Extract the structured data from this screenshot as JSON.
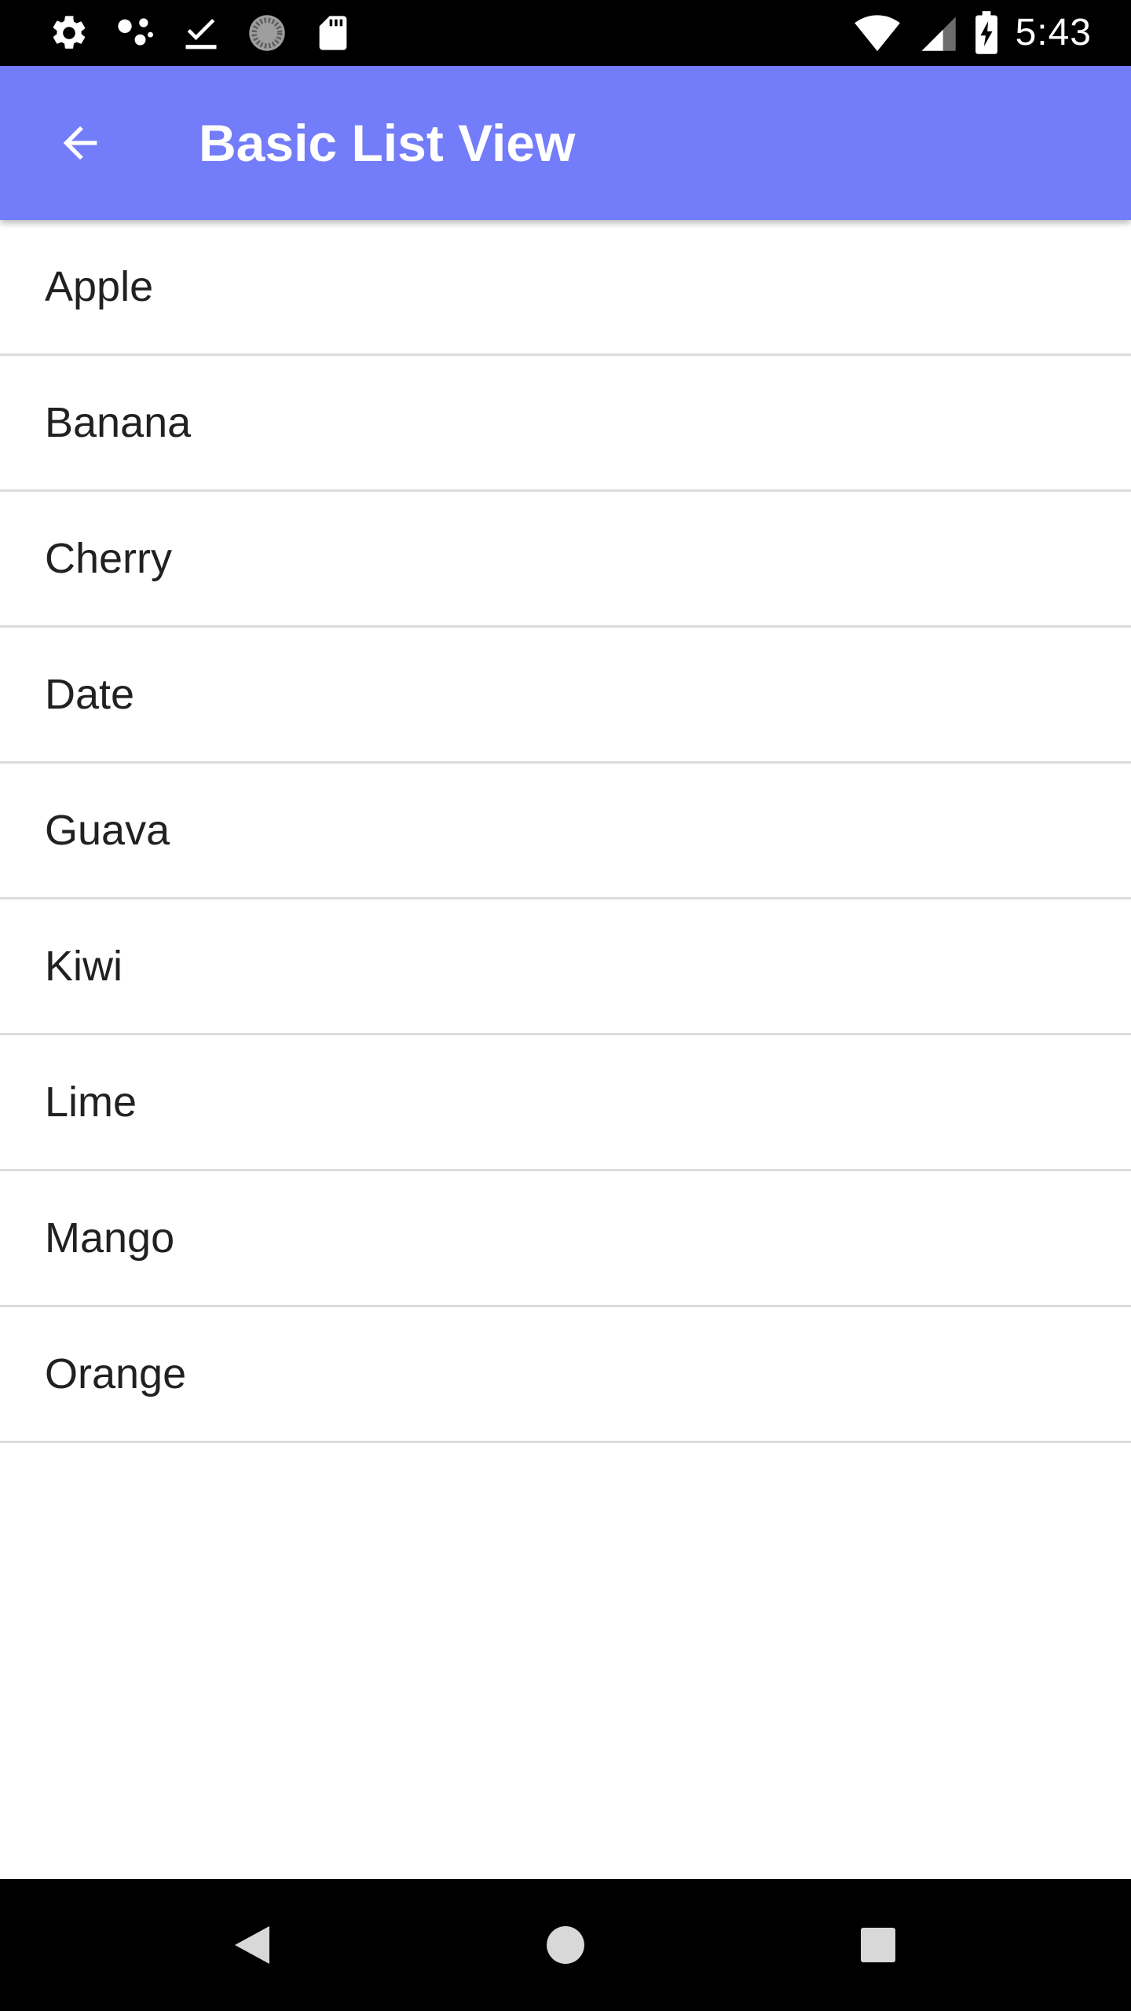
{
  "status_bar": {
    "time": "5:43",
    "left_icons": [
      "settings-icon",
      "assistant-dots-icon",
      "download-done-icon",
      "sync-progress-icon",
      "sd-card-icon"
    ],
    "right_icons": [
      "wifi-icon",
      "cell-signal-icon",
      "battery-charging-icon"
    ]
  },
  "app_bar": {
    "title": "Basic List View",
    "back_icon": "arrow-back-icon",
    "color": "#737cf9"
  },
  "list": {
    "items": [
      {
        "label": "Apple"
      },
      {
        "label": "Banana"
      },
      {
        "label": "Cherry"
      },
      {
        "label": "Date"
      },
      {
        "label": "Guava"
      },
      {
        "label": "Kiwi"
      },
      {
        "label": "Lime"
      },
      {
        "label": "Mango"
      },
      {
        "label": "Orange"
      }
    ]
  },
  "nav_bar": {
    "icons": [
      "nav-back-icon",
      "nav-home-icon",
      "nav-recents-icon"
    ]
  }
}
